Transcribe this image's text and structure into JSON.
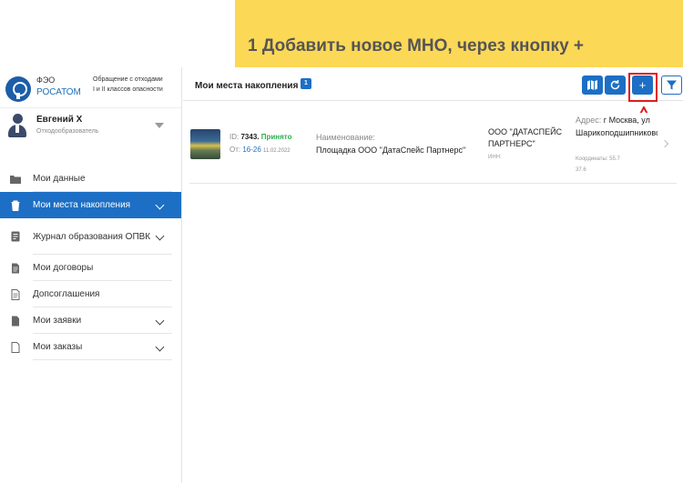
{
  "banner": {
    "text": "1 Добавить новое МНО, через кнопку +"
  },
  "logo": {
    "line1": "ФЭО",
    "line2": "РОСАТОМ",
    "subtitle1": "Обращение с отходами",
    "subtitle2": "I и II классов опасности"
  },
  "user": {
    "name": "Евгений Х",
    "role": "Отходообразователь"
  },
  "nav": {
    "items": [
      {
        "label": "Мои данные",
        "icon": "folder-icon"
      },
      {
        "label": "Мои места накопления",
        "icon": "trash-icon",
        "active": true,
        "expandable": true
      },
      {
        "label": "Журнал образования ОПВК",
        "icon": "journal-icon",
        "expandable": true
      },
      {
        "label": "Мои договоры",
        "icon": "document-icon"
      },
      {
        "label": "Допсоглашения",
        "icon": "document-outline-icon"
      },
      {
        "label": "Мои заявки",
        "icon": "request-icon",
        "expandable": true
      },
      {
        "label": "Мои заказы",
        "icon": "order-icon",
        "expandable": true
      }
    ]
  },
  "header": {
    "title": "Мои места накопления",
    "count": "1",
    "buttons": {
      "map": "map-icon",
      "refresh": "refresh-icon",
      "add": "+",
      "filter": "filter-icon"
    }
  },
  "card": {
    "id_label": "ID:",
    "id_value": "7343.",
    "status": "Принято",
    "date_label": "От:",
    "time": "16-26",
    "date": "11.02.2022",
    "name_label": "Наименование:",
    "name_value": "Площадка ООО \"ДатаСпейс Партнерс\"",
    "org": "ООО \"ДАТАСПЕЙС ПАРТНЕРС\"",
    "inn_label": "ИНН:",
    "address_label": "Адрес:",
    "address_value": "г Москва, ул Шарикоподшипниковская,",
    "coords_label": "Координаты: 55.7",
    "coords_more": "37.6"
  },
  "colors": {
    "accent": "#1c6fc4",
    "banner": "#fcd857",
    "highlight": "#e21b1b",
    "status_ok": "#2eae52"
  }
}
